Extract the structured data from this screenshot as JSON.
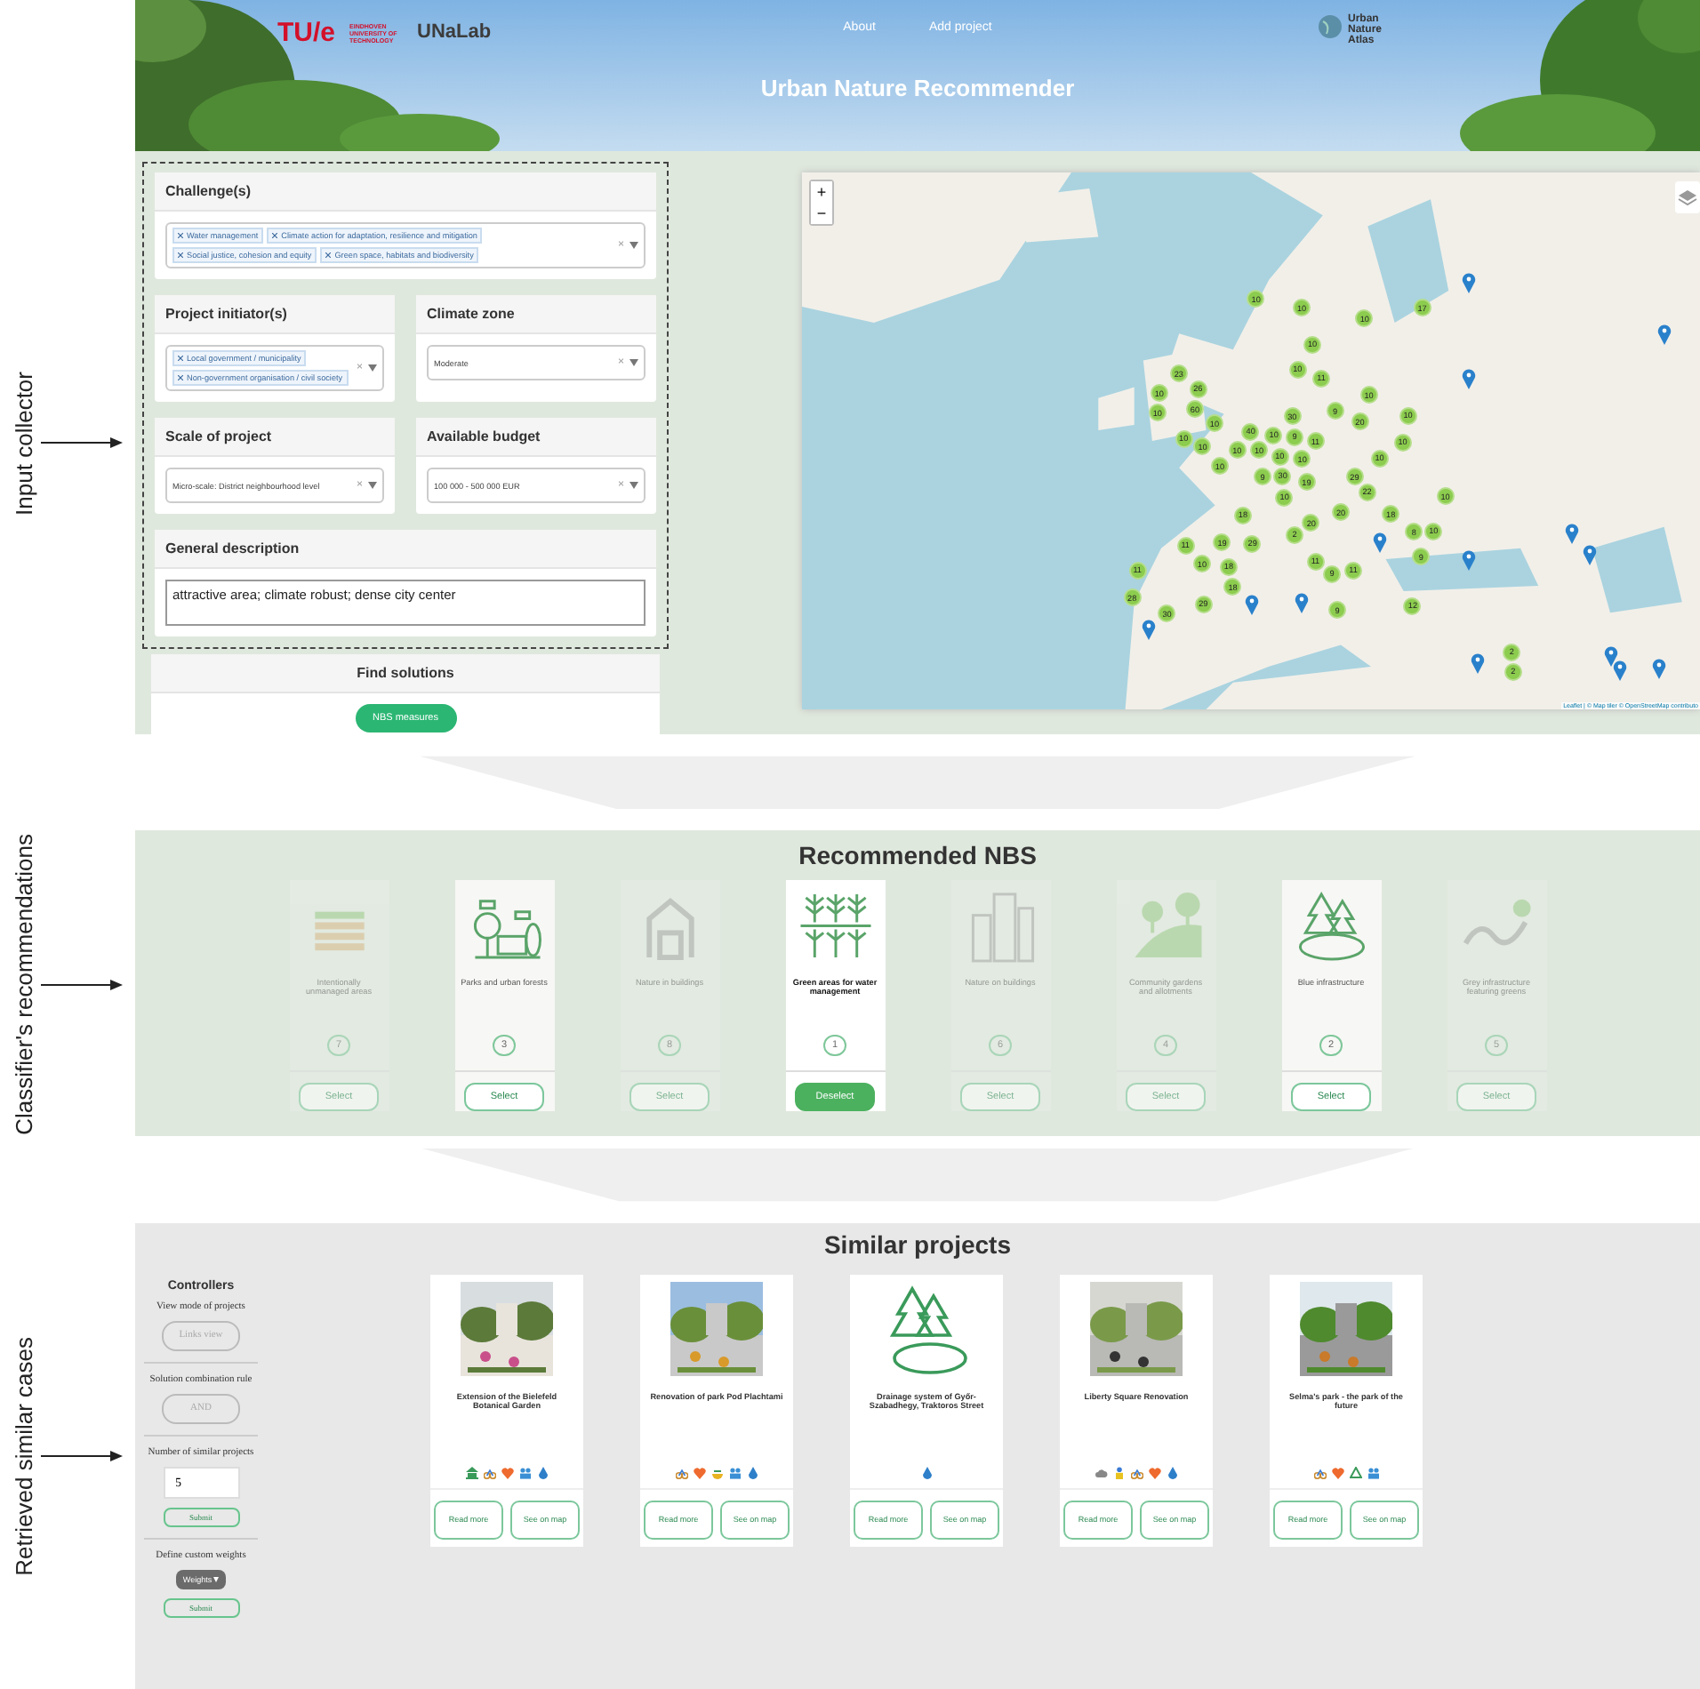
{
  "annotations": [
    {
      "label": "Input collector"
    },
    {
      "label": "Classifier's recommendations"
    },
    {
      "label": "Retrieved similar cases"
    }
  ],
  "header": {
    "tue_logo": "TU/e",
    "tue_subtitle": "EINDHOVEN UNIVERSITY OF TECHNOLOGY",
    "unalab_logo": "UNaLab",
    "nav": [
      "About",
      "Add project"
    ],
    "title": "Urban Nature Recommender",
    "atlas_logo": "Urban Nature Atlas"
  },
  "input_collector": {
    "challenges": {
      "title": "Challenge(s)",
      "tags": [
        "Water management",
        "Climate action for adaptation, resilience and mitigation",
        "Social justice, cohesion and equity",
        "Green space, habitats and biodiversity"
      ],
      "clear": "×"
    },
    "initiators": {
      "title": "Project initiator(s)",
      "tags": [
        "Local government / municipality",
        "Non-government organisation / civil society"
      ],
      "clear": "×"
    },
    "climate_zone": {
      "title": "Climate zone",
      "value": "Moderate",
      "clear": "×"
    },
    "scale": {
      "title": "Scale of project",
      "value": "Micro-scale: District neighbourhood level",
      "clear": "×"
    },
    "budget": {
      "title": "Available budget",
      "value": "100 000 - 500 000 EUR",
      "clear": "×"
    },
    "description": {
      "title": "General description",
      "value": "attractive area; climate robust; dense city center"
    },
    "find": {
      "title": "Find solutions",
      "button": "NBS measures"
    }
  },
  "map": {
    "zoom_in": "+",
    "zoom_out": "−",
    "attribution": "Leaflet | © Map tiler © OpenStreetMap contributo",
    "clusters": [
      "10",
      "10",
      "17",
      "10",
      "10",
      "23",
      "10",
      "11",
      "10",
      "26",
      "10",
      "10",
      "60",
      "30",
      "9",
      "10",
      "10",
      "20",
      "10",
      "40",
      "10",
      "9",
      "11",
      "10",
      "10",
      "10",
      "10",
      "10",
      "10",
      "10",
      "10",
      "9",
      "30",
      "29",
      "19",
      "10",
      "22",
      "10",
      "18",
      "20",
      "18",
      "20",
      "2",
      "8",
      "10",
      "11",
      "19",
      "29",
      "9",
      "11",
      "11",
      "10",
      "18",
      "9",
      "11",
      "18",
      "28",
      "30",
      "29",
      "9",
      "12",
      "2",
      "2"
    ]
  },
  "recommended": {
    "title": "Recommended NBS",
    "cards": [
      {
        "kind": "bricks",
        "name": "Intentionally unmanaged areas",
        "rank": "7",
        "available": false,
        "selected": false,
        "button": "Select"
      },
      {
        "kind": "park",
        "name": "Parks and urban forests",
        "rank": "3",
        "available": true,
        "selected": false,
        "button": "Select"
      },
      {
        "kind": "barn",
        "name": "Nature in buildings",
        "rank": "8",
        "available": false,
        "selected": false,
        "button": "Select"
      },
      {
        "kind": "crops",
        "name": "Green areas for water management",
        "rank": "1",
        "available": true,
        "selected": true,
        "button": "Deselect"
      },
      {
        "kind": "city",
        "name": "Nature on buildings",
        "rank": "6",
        "available": false,
        "selected": false,
        "button": "Select"
      },
      {
        "kind": "hills",
        "name": "Community gardens and allotments",
        "rank": "4",
        "available": false,
        "selected": false,
        "button": "Select"
      },
      {
        "kind": "pond",
        "name": "Blue infrastructure",
        "rank": "2",
        "available": true,
        "selected": false,
        "button": "Select"
      },
      {
        "kind": "pipe",
        "name": "Grey infrastructure featuring greens",
        "rank": "5",
        "available": false,
        "selected": false,
        "button": "Select"
      }
    ]
  },
  "similar": {
    "title": "Similar projects",
    "controllers": {
      "title": "Controllers",
      "view_label": "View mode of projects",
      "view_button": "Links view",
      "rule_label": "Solution combination rule",
      "rule_button": "AND",
      "number_label": "Number of similar projects",
      "number_value": "5",
      "number_submit": "Submit",
      "weights_label": "Define custom weights",
      "weights_button": "Weights",
      "weights_submit": "Submit"
    },
    "projects": [
      {
        "kind": "picture",
        "title": "Extension of the Bielefeld Botanical Garden",
        "badges": [
          {
            "kind": "museum"
          },
          {
            "kind": "bike"
          },
          {
            "kind": "heart"
          },
          {
            "kind": "people"
          },
          {
            "kind": "drop"
          }
        ],
        "read": "Read more",
        "map": "See on map"
      },
      {
        "kind": "picture",
        "title": "Renovation of park Pod Plachtami",
        "badges": [
          {
            "kind": "bike"
          },
          {
            "kind": "heart"
          },
          {
            "kind": "bowl"
          },
          {
            "kind": "people"
          },
          {
            "kind": "drop"
          }
        ],
        "read": "Read more",
        "map": "See on map"
      },
      {
        "kind": "icon",
        "title": "Drainage system of Győr-Szabadhegy, Traktoros Street",
        "badges": [
          {
            "kind": "drop"
          }
        ],
        "read": "Read more",
        "map": "See on map"
      },
      {
        "kind": "picture",
        "title": "Liberty Square Renovation",
        "badges": [
          {
            "kind": "cloud"
          },
          {
            "kind": "person"
          },
          {
            "kind": "bike"
          },
          {
            "kind": "heart"
          },
          {
            "kind": "drop"
          }
        ],
        "read": "Read more",
        "map": "See on map"
      },
      {
        "kind": "picture",
        "title": "Selma's park - the park of the future",
        "badges": [
          {
            "kind": "bike"
          },
          {
            "kind": "heart"
          },
          {
            "kind": "recycle"
          },
          {
            "kind": "people"
          }
        ],
        "read": "Read more",
        "map": "See on map"
      }
    ]
  }
}
